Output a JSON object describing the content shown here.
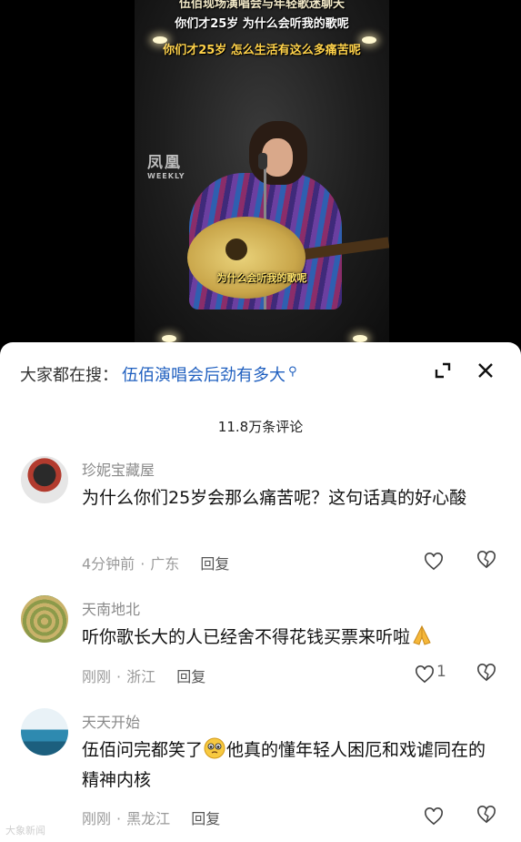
{
  "video": {
    "subtitle_top_cut": "伍佰现场演唱会与年轻歌迷聊天",
    "subtitle_line1": "你们才25岁 为什么会听我的歌呢",
    "subtitle_line2": "你们才25岁 怎么生活有这么多痛苦呢",
    "subtitle_bottom": "为什么会听我的歌呢",
    "watermark": "凤凰",
    "watermark_sub": "WEEKLY"
  },
  "search_bar": {
    "prefix": "大家都在搜：",
    "query": "伍佰演唱会后劲有多大",
    "icon": "search-icon"
  },
  "header_icons": {
    "collapse": "collapse-icon",
    "close": "close-icon"
  },
  "comment_count": "11.8万条评论",
  "comments": [
    {
      "username": "珍妮宝藏屋",
      "text": "为什么你们25岁会那么痛苦呢？这句话真的好心酸",
      "time": "4分钟前",
      "location": "广东",
      "reply": "回复",
      "likes": ""
    },
    {
      "username": "天南地北",
      "text": "听你歌长大的人已经舍不得花钱买票来听啦",
      "emoji": "pray-emoji",
      "time": "刚刚",
      "location": "浙江",
      "reply": "回复",
      "likes": "1"
    },
    {
      "username": "天天开始",
      "text_a": "伍佰问完都笑了",
      "emoji": "teary-face-emoji",
      "text_b": "他真的懂年轻人困厄和戏谑同在的精神内核",
      "time": "刚刚",
      "location": "黑龙江",
      "reply": "回复",
      "likes": ""
    }
  ],
  "corner_watermark": "大象新闻",
  "colors": {
    "link": "#1f5fbf",
    "meta": "#9a9a9a",
    "panel_bg": "#ffffff"
  }
}
